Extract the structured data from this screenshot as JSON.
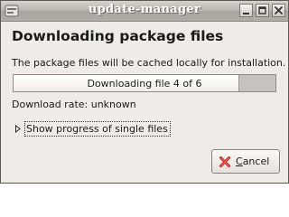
{
  "window": {
    "title": "update-manager",
    "title_icon": "update-manager-app-icon",
    "controls": [
      "minimize-icon",
      "maximize-icon",
      "close-icon"
    ]
  },
  "dialog": {
    "heading": "Downloading package files",
    "description": "The package files will be cached locally for installation.",
    "progress": {
      "text": "Downloading file 4 of 6",
      "fraction": 0.857
    },
    "download_rate": "Download rate: unknown",
    "expander": {
      "label": "Show progress of single files",
      "expanded": false,
      "arrow_icon": "triangle-right-icon"
    },
    "cancel_button": {
      "mnemonic": "C",
      "label_rest": "ancel",
      "icon": "cancel-x-icon"
    }
  },
  "colors": {
    "window_bg": "#efebe7",
    "title_text": "#ffffff",
    "progress_fill": "#ffffff",
    "progress_track": "#c6c3bf",
    "cancel_icon": "#cc1f1a"
  }
}
